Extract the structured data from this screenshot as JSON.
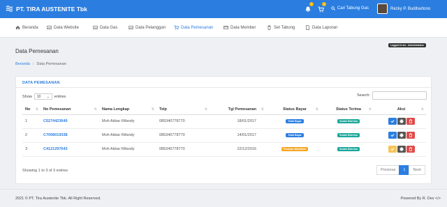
{
  "header": {
    "brand": "PT. TIRA AUSTENITE Tbk",
    "bell_count": "0",
    "cart_count": "0",
    "search_link": "Cari Tabung Gas",
    "user_name": "Rezky P. Budihartono"
  },
  "nav": {
    "items": [
      {
        "label": "Beranda",
        "icon": "home-icon"
      },
      {
        "label": "Data Website",
        "icon": "image-icon"
      },
      {
        "label": "Data Gas",
        "icon": "image-icon"
      },
      {
        "label": "Data Pelanggan",
        "icon": "image-icon"
      },
      {
        "label": "Data Pemesanan",
        "icon": "cart-icon",
        "active": true
      },
      {
        "label": "Data Member",
        "icon": "card-icon"
      },
      {
        "label": "Set Tabung",
        "icon": "trash-icon"
      },
      {
        "label": "Data Laporan",
        "icon": "document-icon"
      }
    ]
  },
  "page": {
    "title": "Data Pemesanan",
    "logged_in": "Logged In As : Administrator",
    "breadcrumb": {
      "home": "Beranda",
      "current": "Data Pemesanan"
    }
  },
  "card": {
    "title": "DATA PEMESANAN",
    "show_label": "Show",
    "entries_value": "10",
    "entries_label": "entries",
    "search_label": "Search:",
    "search_value": "",
    "columns": [
      "No",
      "No Pemesanan",
      "Nama Lengkap",
      "Telp",
      "Tgl Pemesanan",
      "Status Bayar",
      "Status Terima",
      "Aksi"
    ],
    "rows": [
      {
        "no": "1",
        "order": "C5274423640",
        "name": "Moh Akbar Rifandy",
        "telp": "085340778770",
        "date": "18/01/2017",
        "bayar": "Telah Bayar",
        "bayar_color": "#2b7ee0",
        "terima": "Sudah Diterima",
        "terima_color": "#1aa89a"
      },
      {
        "no": "2",
        "order": "C7008019338",
        "name": "Moh Akbar Rifandy",
        "telp": "085340778770",
        "date": "14/01/2017",
        "bayar": "Telah Bayar",
        "bayar_color": "#2b7ee0",
        "terima": "Sudah Diterima",
        "terima_color": "#1aa89a"
      },
      {
        "no": "3",
        "order": "C4121297643",
        "name": "Moh Akbar Rifandy",
        "telp": "085340778770",
        "date": "22/12/2016",
        "bayar": "Pesanan dibatalkan",
        "bayar_color": "#f5a623",
        "terima": "Sudah Diterima",
        "terima_color": "#1aa89a"
      }
    ],
    "showing": "Showing 1 to 3 of 3 entries",
    "pager": {
      "prev": "Previous",
      "page": "1",
      "next": "Next"
    }
  },
  "footer": {
    "left": "2021 © PT. Tira Austenite Tbk. All Right Reserved.",
    "right": "Powered By R. Dev </>"
  }
}
